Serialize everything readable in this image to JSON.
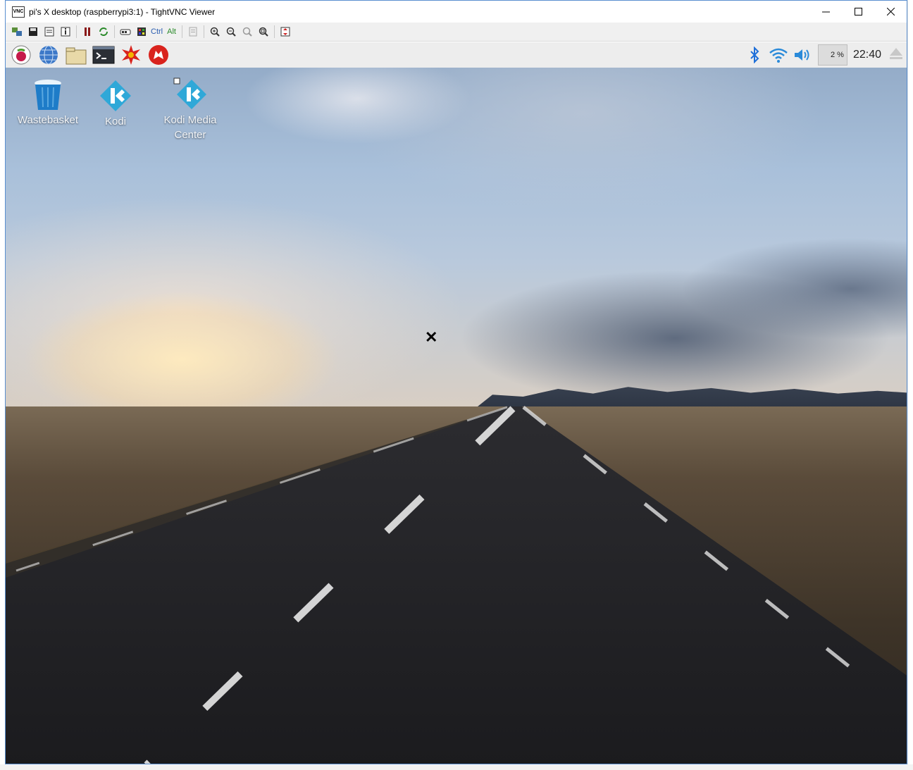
{
  "window": {
    "title": "pi's X desktop (raspberrypi3:1) - TightVNC Viewer",
    "app_icon_text": "VNC"
  },
  "toolbar": {
    "ctrl_label": "Ctrl",
    "alt_label": "Alt",
    "buttons": [
      "new-connection-icon",
      "save-icon",
      "options-icon",
      "info-icon",
      "pause-icon",
      "refresh-icon",
      "ctrl-alt-del-icon",
      "ctrl-esc-icon",
      "ctrl-key",
      "alt-key",
      "clipboard-icon",
      "zoom-in-icon",
      "zoom-out-icon",
      "zoom-100-icon",
      "zoom-fit-icon",
      "fullscreen-icon"
    ]
  },
  "panel": {
    "launchers": [
      "raspberry-menu-icon",
      "web-browser-icon",
      "file-manager-icon",
      "terminal-icon",
      "math-kernel-icon",
      "wolfram-icon"
    ],
    "cpu_usage": "2 %",
    "clock": "22:40"
  },
  "desktop": {
    "icons": [
      {
        "label": "Wastebasket"
      },
      {
        "label": "Kodi"
      },
      {
        "label_line1": "Kodi Media",
        "label_line2": "Center"
      }
    ]
  },
  "colors": {
    "window_border": "#5a8fd0",
    "panel_bg": "#ededed",
    "bluetooth": "#1e6fd9",
    "kodi_blue": "#2fa8d8"
  }
}
